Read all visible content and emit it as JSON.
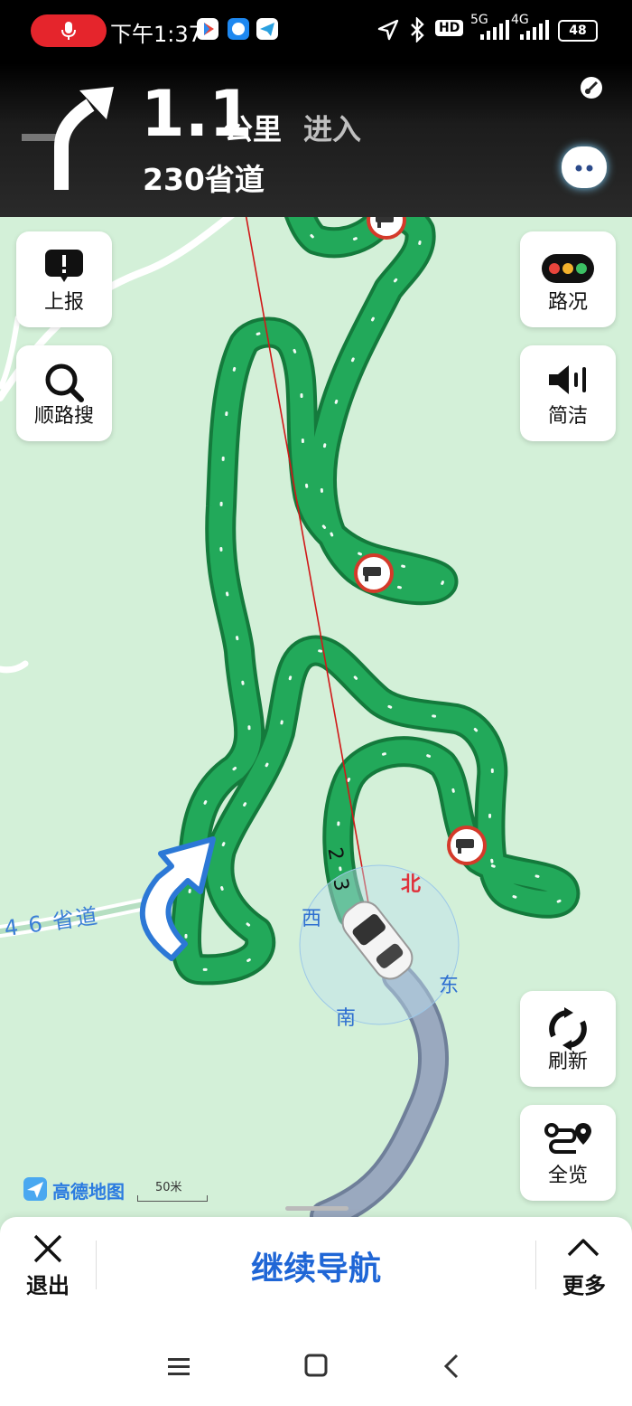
{
  "status_bar": {
    "time": "下午1:37",
    "hd_badge": "HD",
    "net_5g": "5G",
    "net_4g": "4G",
    "battery": "48"
  },
  "nav": {
    "distance": "1.1",
    "unit": "公里",
    "action": "进入",
    "road": "230省道",
    "turn_icon": "turn-right-arrow"
  },
  "map": {
    "road_label_246": "4 6 省道",
    "road_label_230a": "2",
    "road_label_230b": "3",
    "compass_north": "北",
    "compass_south": "南",
    "compass_east": "东",
    "compass_west": "西",
    "logo": "高德地图",
    "scale": "50米",
    "colors": {
      "map_bg": "#d3f0d8",
      "route_green": "#22a95a",
      "route_border": "#147a3c",
      "passed_route": "#9aa9bf",
      "compass_blue": "#2e6fd0",
      "north_red": "#e0303a"
    }
  },
  "left_buttons": [
    {
      "label": "上报",
      "icon": "report-icon"
    },
    {
      "label": "顺路搜",
      "icon": "search-icon"
    }
  ],
  "right_buttons": [
    {
      "label": "路况",
      "icon": "traffic-light-icon"
    },
    {
      "label": "简洁",
      "icon": "speaker-icon"
    },
    {
      "label": "刷新",
      "icon": "refresh-icon"
    },
    {
      "label": "全览",
      "icon": "route-overview-icon"
    }
  ],
  "bottom": {
    "exit_label": "退出",
    "continue_label": "继续导航",
    "more_label": "更多"
  }
}
